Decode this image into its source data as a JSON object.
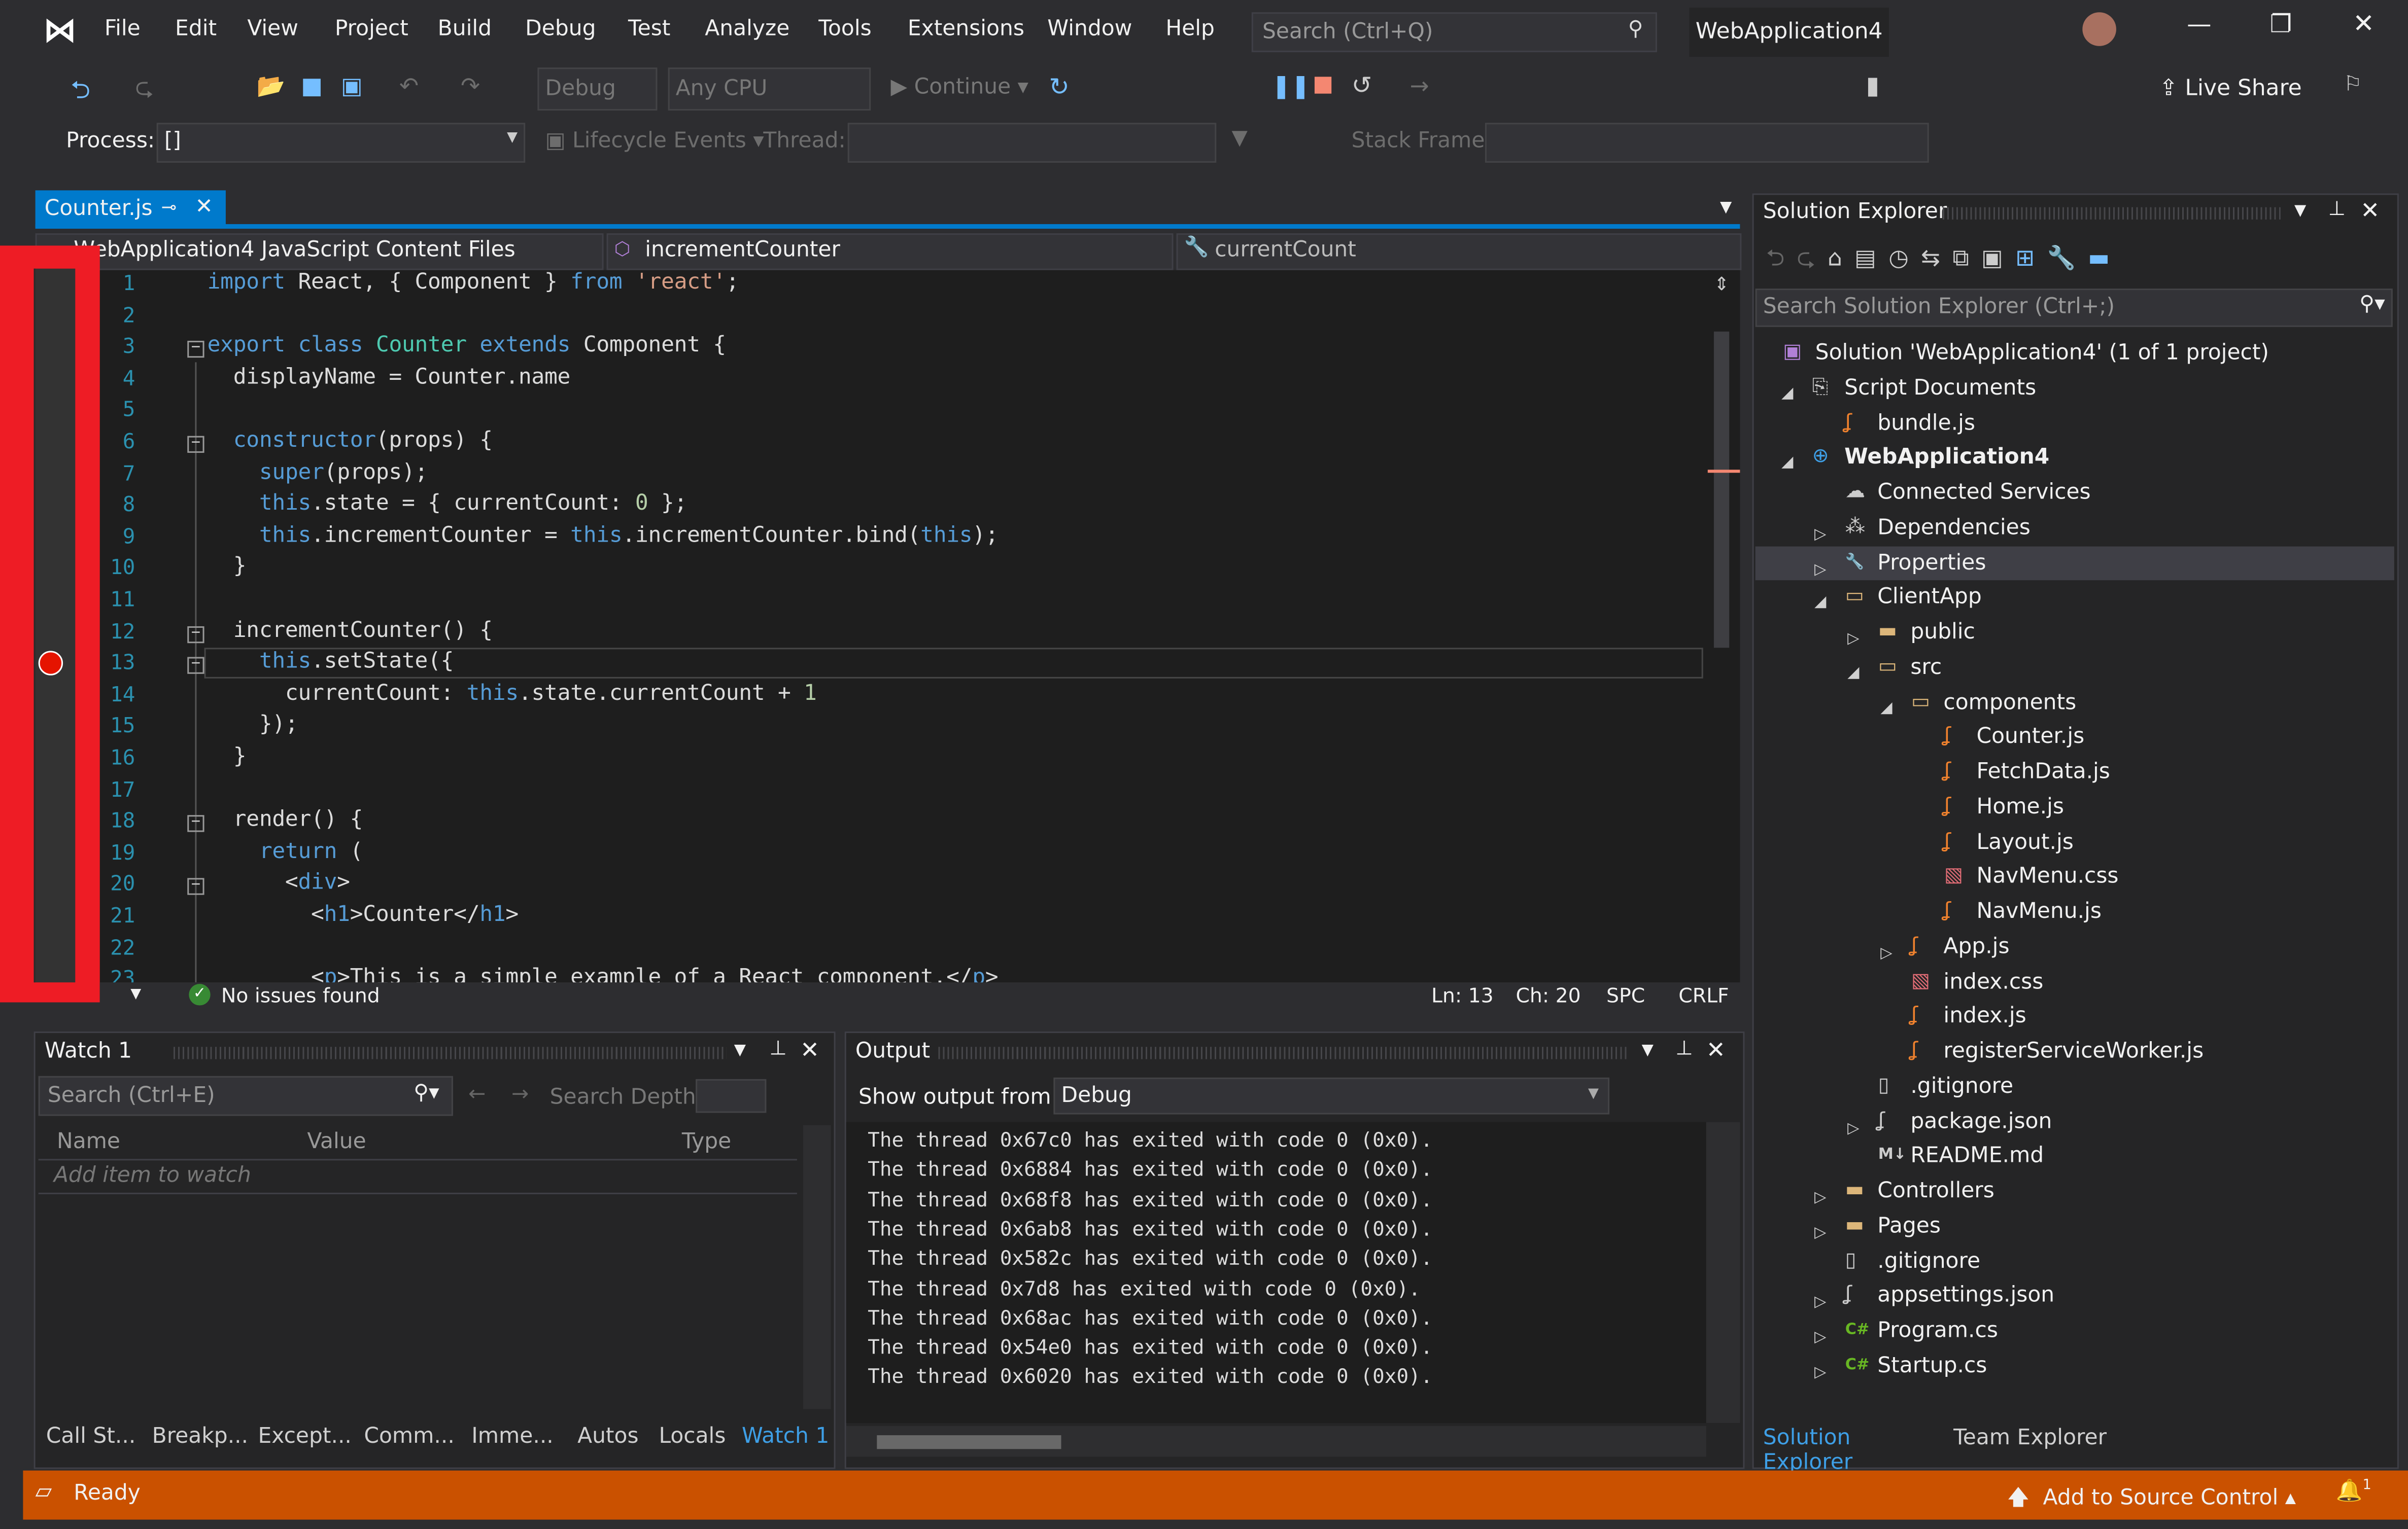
{
  "menu": {
    "items": [
      "File",
      "Edit",
      "View",
      "Project",
      "Build",
      "Debug",
      "Test",
      "Analyze",
      "Tools",
      "Extensions",
      "Window",
      "Help"
    ],
    "search_placeholder": "Search (Ctrl+Q)",
    "solution_name": "WebApplication4"
  },
  "toolbar": {
    "config": "Debug",
    "platform": "Any CPU",
    "continue": "Continue",
    "live_share": "Live Share"
  },
  "debug_location": {
    "process_label": "Process:",
    "process_value": "[]",
    "lifecycle": "Lifecycle Events",
    "thread_label": "Thread:",
    "stack_frame_label": "Stack Frame:"
  },
  "editor": {
    "tab": "Counter.js",
    "nav_project": "WebApplication4 JavaScript Content Files",
    "nav_member": "incrementCounter",
    "nav_field": "currentCount",
    "lines": [
      [
        [
          "import",
          "k"
        ],
        [
          " React, { ",
          "p"
        ],
        [
          "Component",
          "p"
        ],
        [
          " } ",
          "p"
        ],
        [
          "from",
          "k"
        ],
        [
          " ",
          "p"
        ],
        [
          "'react'",
          "s"
        ],
        [
          ";",
          "p"
        ]
      ],
      [],
      [
        [
          "export",
          "k"
        ],
        [
          " ",
          "p"
        ],
        [
          "class",
          "k"
        ],
        [
          " ",
          "p"
        ],
        [
          "Counter",
          "t"
        ],
        [
          " ",
          "p"
        ],
        [
          "extends",
          "k"
        ],
        [
          " Component {",
          "p"
        ]
      ],
      [
        [
          "  displayName = Counter.name",
          "p"
        ]
      ],
      [],
      [
        [
          "  ",
          "p"
        ],
        [
          "constructor",
          "k"
        ],
        [
          "(props) {",
          "p"
        ]
      ],
      [
        [
          "    ",
          "p"
        ],
        [
          "super",
          "k"
        ],
        [
          "(props);",
          "p"
        ]
      ],
      [
        [
          "    ",
          "p"
        ],
        [
          "this",
          "k"
        ],
        [
          ".state = { currentCount: ",
          "p"
        ],
        [
          "0",
          "n"
        ],
        [
          " };",
          "p"
        ]
      ],
      [
        [
          "    ",
          "p"
        ],
        [
          "this",
          "k"
        ],
        [
          ".incrementCounter = ",
          "p"
        ],
        [
          "this",
          "k"
        ],
        [
          ".incrementCounter.bind(",
          "p"
        ],
        [
          "this",
          "k"
        ],
        [
          ");",
          "p"
        ]
      ],
      [
        [
          "  }",
          "p"
        ]
      ],
      [],
      [
        [
          "  incrementCounter() {",
          "p"
        ]
      ],
      [
        [
          "    ",
          "p"
        ],
        [
          "this",
          "k"
        ],
        [
          ".setState({",
          "p"
        ]
      ],
      [
        [
          "      currentCount: ",
          "p"
        ],
        [
          "this",
          "k"
        ],
        [
          ".state.currentCount + ",
          "p"
        ],
        [
          "1",
          "n"
        ]
      ],
      [
        [
          "    });",
          "p"
        ]
      ],
      [
        [
          "  }",
          "p"
        ]
      ],
      [],
      [
        [
          "  render() {",
          "p"
        ]
      ],
      [
        [
          "    ",
          "p"
        ],
        [
          "return",
          "k"
        ],
        [
          " (",
          "p"
        ]
      ],
      [
        [
          "      <",
          "p"
        ],
        [
          "div",
          "k"
        ],
        [
          ">",
          "p"
        ]
      ],
      [
        [
          "        <",
          "p"
        ],
        [
          "h1",
          "k"
        ],
        [
          ">Counter</",
          "p"
        ],
        [
          "h1",
          "k"
        ],
        [
          ">",
          "p"
        ]
      ],
      [],
      [
        [
          "        <",
          "p"
        ],
        [
          "p",
          "k"
        ],
        [
          ">This is a simple example of a React component.</",
          "p"
        ],
        [
          "p",
          "k"
        ],
        [
          ">",
          "p"
        ]
      ]
    ],
    "issues": "No issues found",
    "ln": "Ln: 13",
    "ch": "Ch: 20",
    "spc": "SPC",
    "crlf": "CRLF"
  },
  "watch": {
    "title": "Watch 1",
    "search_placeholder": "Search (Ctrl+E)",
    "depth_label": "Search Depth:",
    "columns": [
      "Name",
      "Value",
      "Type"
    ],
    "add_item": "Add item to watch"
  },
  "output": {
    "title": "Output",
    "show_from_label": "Show output from:",
    "source": "Debug",
    "lines": [
      "The thread 0x67c0 has exited with code 0 (0x0).",
      "The thread 0x6884 has exited with code 0 (0x0).",
      "The thread 0x68f8 has exited with code 0 (0x0).",
      "The thread 0x6ab8 has exited with code 0 (0x0).",
      "The thread 0x582c has exited with code 0 (0x0).",
      "The thread 0x7d8 has exited with code 0 (0x0).",
      "The thread 0x68ac has exited with code 0 (0x0).",
      "The thread 0x54e0 has exited with code 0 (0x0).",
      "The thread 0x6020 has exited with code 0 (0x0)."
    ]
  },
  "bottom_tabs": [
    "Call St...",
    "Breakp...",
    "Except...",
    "Comm...",
    "Imme...",
    "Autos",
    "Locals",
    "Watch 1"
  ],
  "solution_explorer": {
    "title": "Solution Explorer",
    "search_placeholder": "Search Solution Explorer (Ctrl+;)",
    "items": [
      {
        "label": "Solution 'WebApplication4' (1 of 1 project)",
        "level": 0,
        "exp": "",
        "icon": "solution"
      },
      {
        "label": "Script Documents",
        "level": 1,
        "exp": "open",
        "icon": "scripts"
      },
      {
        "label": "bundle.js",
        "level": 2,
        "exp": "",
        "icon": "js"
      },
      {
        "label": "WebApplication4",
        "level": 1,
        "exp": "open",
        "icon": "web",
        "bold": true
      },
      {
        "label": "Connected Services",
        "level": 2,
        "exp": "",
        "icon": "cloud"
      },
      {
        "label": "Dependencies",
        "level": 2,
        "exp": "closed",
        "icon": "deps"
      },
      {
        "label": "Properties",
        "level": 2,
        "exp": "closed",
        "icon": "wrench",
        "selected": true
      },
      {
        "label": "ClientApp",
        "level": 2,
        "exp": "open",
        "icon": "folder-open"
      },
      {
        "label": "public",
        "level": 3,
        "exp": "closed",
        "icon": "folder"
      },
      {
        "label": "src",
        "level": 3,
        "exp": "open",
        "icon": "folder-open"
      },
      {
        "label": "components",
        "level": 4,
        "exp": "open",
        "icon": "folder-open"
      },
      {
        "label": "Counter.js",
        "level": 5,
        "exp": "",
        "icon": "js"
      },
      {
        "label": "FetchData.js",
        "level": 5,
        "exp": "",
        "icon": "js"
      },
      {
        "label": "Home.js",
        "level": 5,
        "exp": "",
        "icon": "js"
      },
      {
        "label": "Layout.js",
        "level": 5,
        "exp": "",
        "icon": "js"
      },
      {
        "label": "NavMenu.css",
        "level": 5,
        "exp": "",
        "icon": "css"
      },
      {
        "label": "NavMenu.js",
        "level": 5,
        "exp": "",
        "icon": "js"
      },
      {
        "label": "App.js",
        "level": 4,
        "exp": "closed",
        "icon": "js"
      },
      {
        "label": "index.css",
        "level": 4,
        "exp": "",
        "icon": "css"
      },
      {
        "label": "index.js",
        "level": 4,
        "exp": "",
        "icon": "js"
      },
      {
        "label": "registerServiceWorker.js",
        "level": 4,
        "exp": "",
        "icon": "js"
      },
      {
        "label": ".gitignore",
        "level": 3,
        "exp": "",
        "icon": "file"
      },
      {
        "label": "package.json",
        "level": 3,
        "exp": "closed",
        "icon": "json"
      },
      {
        "label": "README.md",
        "level": 3,
        "exp": "",
        "icon": "md"
      },
      {
        "label": "Controllers",
        "level": 2,
        "exp": "closed",
        "icon": "folder"
      },
      {
        "label": "Pages",
        "level": 2,
        "exp": "closed",
        "icon": "folder"
      },
      {
        "label": ".gitignore",
        "level": 2,
        "exp": "",
        "icon": "file"
      },
      {
        "label": "appsettings.json",
        "level": 2,
        "exp": "closed",
        "icon": "json"
      },
      {
        "label": "Program.cs",
        "level": 2,
        "exp": "closed",
        "icon": "cs"
      },
      {
        "label": "Startup.cs",
        "level": 2,
        "exp": "closed",
        "icon": "cs"
      }
    ],
    "tabs": [
      "Solution Explorer",
      "Team Explorer"
    ]
  },
  "status": {
    "ready": "Ready",
    "source_control": "Add to Source Control",
    "notifications": "1"
  },
  "colors": {
    "accent": "#007acc",
    "status_bar": "#ca5100",
    "breakpoint": "#e51400",
    "highlight": "#ee1c25"
  }
}
